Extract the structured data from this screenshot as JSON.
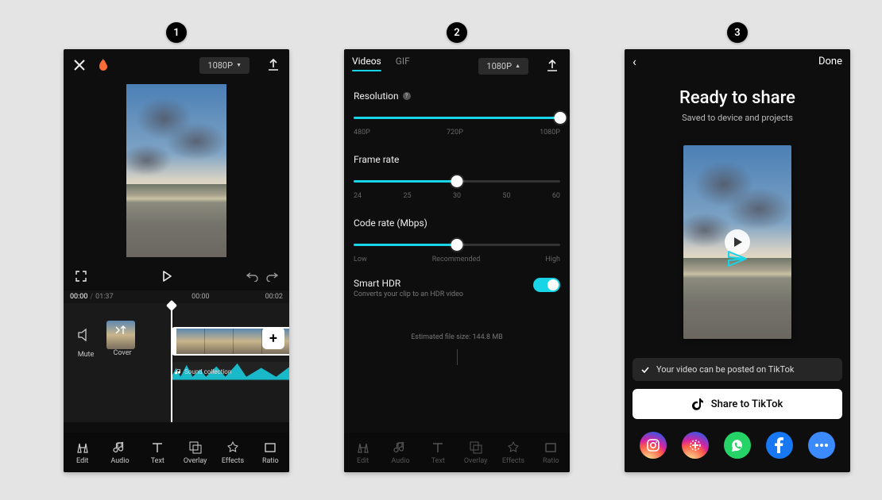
{
  "badges": [
    "1",
    "2",
    "3"
  ],
  "screen1": {
    "resolution_chip": "1080P",
    "time_current": "00:00",
    "time_total": "01:37",
    "ruler": {
      "t0": "00:00",
      "t1": "00:02"
    },
    "side": {
      "mute": "Mute",
      "cover": "Cover"
    },
    "audio_label": "Sound collection",
    "tools": [
      {
        "id": "edit",
        "label": "Edit"
      },
      {
        "id": "audio",
        "label": "Audio"
      },
      {
        "id": "text",
        "label": "Text"
      },
      {
        "id": "overlay",
        "label": "Overlay"
      },
      {
        "id": "effects",
        "label": "Effects"
      },
      {
        "id": "ratio",
        "label": "Ratio"
      }
    ]
  },
  "screen2": {
    "tabs": {
      "videos": "Videos",
      "gif": "GIF"
    },
    "resolution_chip": "1080P",
    "resolution": {
      "label": "Resolution",
      "ticks": [
        "480P",
        "720P",
        "1080P"
      ],
      "value_pct": 100
    },
    "framerate": {
      "label": "Frame rate",
      "ticks": [
        "24",
        "25",
        "30",
        "50",
        "60"
      ],
      "value_pct": 50
    },
    "coderate": {
      "label": "Code rate (Mbps)",
      "ticks": [
        "Low",
        "Recommended",
        "High"
      ],
      "value_pct": 50
    },
    "smart_hdr": {
      "title": "Smart HDR",
      "sub": "Converts your clip to an HDR video",
      "on": true
    },
    "estimate": "Estimated file size: 144.8 MB",
    "tools": [
      {
        "id": "edit",
        "label": "Edit"
      },
      {
        "id": "audio",
        "label": "Audio"
      },
      {
        "id": "text",
        "label": "Text"
      },
      {
        "id": "overlay",
        "label": "Overlay"
      },
      {
        "id": "effects",
        "label": "Effects"
      },
      {
        "id": "ratio",
        "label": "Ratio"
      }
    ]
  },
  "screen3": {
    "done": "Done",
    "title": "Ready to share",
    "subtitle": "Saved to device and projects",
    "notice": "Your video can be posted on TikTok",
    "share": "Share to TikTok",
    "social": [
      "instagram",
      "capcut-template",
      "whatsapp",
      "facebook",
      "more"
    ]
  }
}
